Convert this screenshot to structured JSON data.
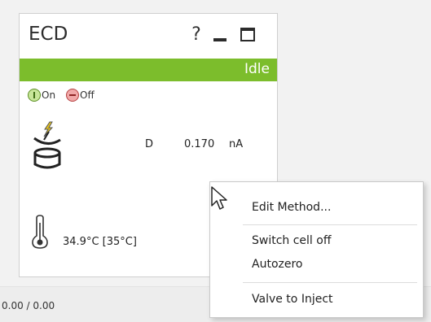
{
  "module": {
    "title": "ECD",
    "help_label": "?",
    "state": "Idle",
    "accent_color": "#7cbd2c",
    "toggles": {
      "on_label": "On",
      "off_label": "Off"
    },
    "signal": {
      "name": "D",
      "value": "0.170",
      "unit": "nA"
    },
    "temperature": "34.9°C  [35°C]",
    "icons": [
      "question-icon",
      "minimize-icon",
      "maximize-icon",
      "power-on-icon",
      "power-off-icon",
      "electrochemical-cell-icon",
      "thermometer-icon"
    ]
  },
  "statusbar": {
    "text": "0.00 / 0.00"
  },
  "context_menu": {
    "items": [
      {
        "label": "Edit Method..."
      },
      {
        "label": "Switch cell off"
      },
      {
        "label": "Autozero"
      },
      {
        "label": "Valve to Inject"
      }
    ]
  }
}
